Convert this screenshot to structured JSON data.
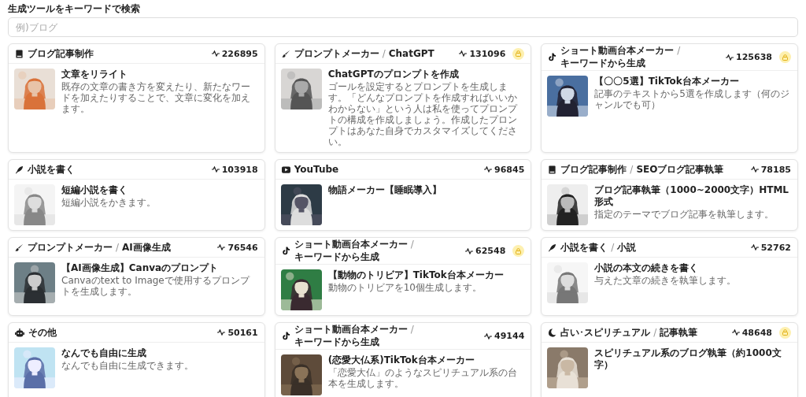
{
  "search": {
    "label": "生成ツールをキーワードで検索",
    "placeholder": "例)ブログ"
  },
  "tools": [
    {
      "kind": "book",
      "category": "ブログ記事制作",
      "count": "226895",
      "locked": false,
      "title": "文章をリライト",
      "description": "既存の文章の書き方を変えたり、新たなワードを加えたりすることで、文章に変化を加えます。"
    },
    {
      "kind": "brush",
      "category": "プロンプトメーカー",
      "separator": "/",
      "subcategory": "ChatGPT",
      "count": "131096",
      "locked": true,
      "title": "ChatGPTのプロンプトを作成",
      "description": "ゴールを設定するとプロンプトを生成します。「どんなプロンプトを作成すればいいかわからない」という人は私を使ってプロンプトの構成を作成しましょう。作成したプロンプトはあなた自身でカスタマイズしてください。"
    },
    {
      "kind": "tiktok",
      "category": "ショート動画台本メーカー",
      "separator": "/",
      "subcategory": "キーワードから生成",
      "count": "125638",
      "locked": true,
      "title": "【〇〇5選】TikTok台本メーカー",
      "description": "記事のテキストから5選を作成します（何のジャンルでも可）"
    },
    {
      "kind": "pen",
      "category": "小説を書く",
      "count": "103918",
      "locked": false,
      "title": "短編小説を書く",
      "description": "短編小説をかきます。"
    },
    {
      "kind": "youtube",
      "category": "YouTube",
      "count": "96845",
      "locked": false,
      "title": "物語メーカー【睡眠導入】"
    },
    {
      "kind": "book",
      "category": "ブログ記事制作",
      "separator": "/",
      "subcategory": "SEOブログ記事執筆",
      "count": "78185",
      "locked": false,
      "title": "ブログ記事執筆（1000~2000文字）HTML形式",
      "description": "指定のテーマでブログ記事を執筆します。"
    },
    {
      "kind": "brush",
      "category": "プロンプトメーカー",
      "separator": "/",
      "subcategory": "AI画像生成",
      "count": "76546",
      "locked": false,
      "title": "【AI画像生成】Canvaのプロンプト",
      "description": "Canvaのtext to Imageで使用するプロンプトを生成します。"
    },
    {
      "kind": "tiktok",
      "category": "ショート動画台本メーカー",
      "separator": "/",
      "subcategory": "キーワードから生成",
      "count": "62548",
      "locked": true,
      "title": "【動物のトリビア】TikTok台本メーカー",
      "description": "動物のトリビアを10個生成します。"
    },
    {
      "kind": "pen",
      "category": "小説を書く",
      "separator": "/",
      "subcategory": "小説",
      "count": "52762",
      "locked": false,
      "title": "小説の本文の続きを書く",
      "description": "与えた文章の続きを執筆します。"
    },
    {
      "kind": "robot",
      "category": "その他",
      "count": "50161",
      "locked": false,
      "title": "なんでも自由に生成",
      "description": "なんでも自由に生成できます。"
    },
    {
      "kind": "tiktok",
      "category": "ショート動画台本メーカー",
      "separator": "/",
      "subcategory": "キーワードから生成",
      "count": "49144",
      "locked": false,
      "title": "(恋愛大仏系)TikTok台本メーカー",
      "description": "「恋愛大仏」のようなスピリチュアル系の台本を生成します。"
    },
    {
      "kind": "moon",
      "category": "占い･スピリチュアル",
      "separator": "/",
      "subcategory": "記事執筆",
      "count": "48648",
      "locked": true,
      "title": "スピリチュアル系のブログ執筆（約1000文字）"
    }
  ]
}
